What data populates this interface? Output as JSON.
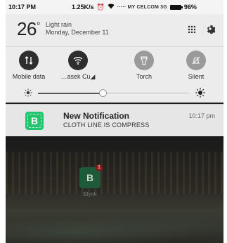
{
  "status_bar": {
    "time": "10:17 PM",
    "speed": "1.25K/s",
    "carrier": "····· MY CELCOM 3G",
    "battery": "96%"
  },
  "weather": {
    "temperature": "26",
    "degree": "°",
    "condition": "Light rain",
    "date": "Monday, December 11"
  },
  "tiles": [
    {
      "label": "Mobile data",
      "icon": "mobile-data-icon",
      "state": "on"
    },
    {
      "label": "…asek Cu◢",
      "icon": "wifi-icon",
      "state": "on"
    },
    {
      "label": "Torch",
      "icon": "torch-icon",
      "state": "off"
    },
    {
      "label": "Silent",
      "icon": "silent-icon",
      "state": "off"
    }
  ],
  "brightness": {
    "level_percent": 38
  },
  "notification": {
    "app_letter": "B",
    "title": "New Notification",
    "body": "CLOTH LINE IS COMPRESS",
    "time": "10:17 pm"
  },
  "home": {
    "app_letter": "B",
    "app_label": "Blynk",
    "badge": "1"
  },
  "colors": {
    "notification_icon": "#25c56f",
    "tile_on": "#2e2e2e",
    "tile_off": "#9a9a9a",
    "shade_bg": "#ececec"
  }
}
